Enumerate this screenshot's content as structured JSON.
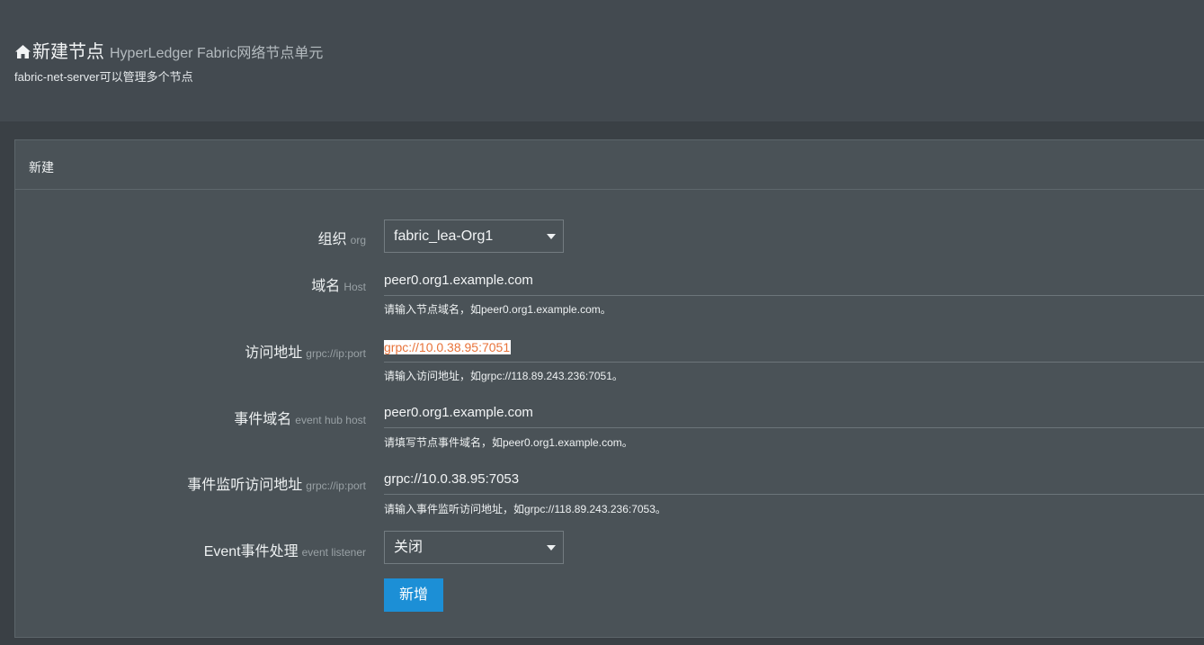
{
  "header": {
    "title": "新建节点",
    "subtitle": "HyperLedger Fabric网络节点单元",
    "description": "fabric-net-server可以管理多个节点"
  },
  "panel": {
    "title": "新建"
  },
  "form": {
    "org": {
      "label": "组织",
      "hint": "org",
      "value": "fabric_lea-Org1"
    },
    "host": {
      "label": "域名",
      "hint": "Host",
      "value": "peer0.org1.example.com",
      "help": "请输入节点域名，如peer0.org1.example.com。"
    },
    "location": {
      "label": "访问地址",
      "hint": "grpc://ip:port",
      "value": "grpc://10.0.38.95:7051",
      "help": "请输入访问地址，如grpc://118.89.243.236:7051。"
    },
    "event_host": {
      "label": "事件域名",
      "hint": "event hub host",
      "value": "peer0.org1.example.com",
      "help": "请填写节点事件域名，如peer0.org1.example.com。"
    },
    "event_location": {
      "label": "事件监听访问地址",
      "hint": "grpc://ip:port",
      "value": "grpc://10.0.38.95:7053",
      "help": "请输入事件监听访问地址，如grpc://118.89.243.236:7053。"
    },
    "event_listener": {
      "label": "Event事件处理",
      "hint": "event listener",
      "value": "关闭"
    },
    "submit_label": "新增"
  },
  "colors": {
    "header_bg": "#434a50",
    "panel_bg": "#4a5257",
    "accent": "#1c8fd6",
    "selection_text": "#e8733a"
  }
}
